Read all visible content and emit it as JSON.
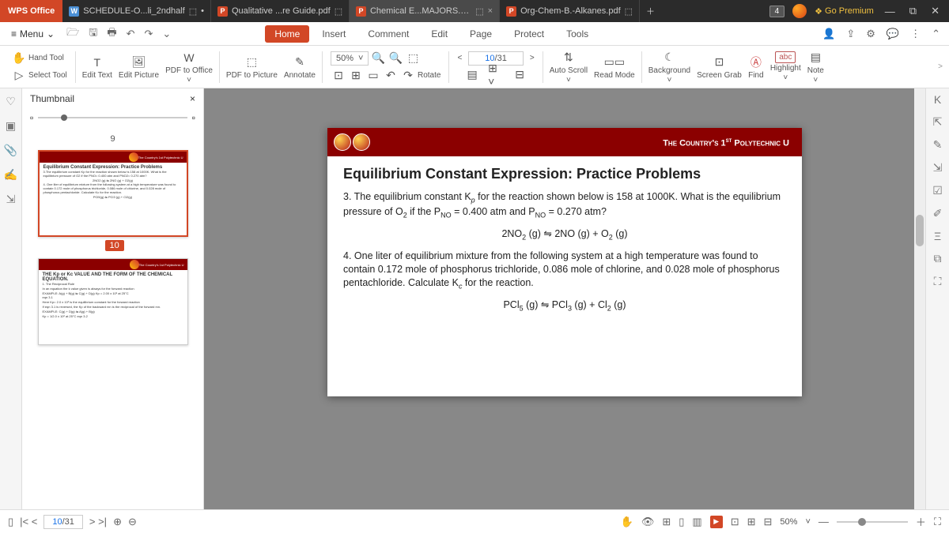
{
  "titlebar": {
    "logo": "WPS Office",
    "tabs": [
      {
        "icon": "w",
        "label": "SCHEDULE-O...li_2ndhalf"
      },
      {
        "icon": "p",
        "label": "Qualitative ...re Guide.pdf"
      },
      {
        "icon": "p",
        "label": "Chemical E...MAJORS.pdf",
        "active": true
      },
      {
        "icon": "p",
        "label": "Org-Chem-B.-Alkanes.pdf"
      }
    ],
    "badge": "4",
    "premium": "Go Premium"
  },
  "menubar": {
    "menu": "Menu",
    "tabs": [
      "Home",
      "Insert",
      "Comment",
      "Edit",
      "Page",
      "Protect",
      "Tools"
    ]
  },
  "toolbar": {
    "hand": "Hand Tool",
    "select": "Select Tool",
    "edittext": "Edit Text",
    "editpic": "Edit Picture",
    "pdf2office": "PDF to Office",
    "pdf2pic": "PDF to Picture",
    "annotate": "Annotate",
    "zoom": "50%",
    "rotate": "Rotate",
    "page_cur": "10",
    "page_total": "/31",
    "autoscroll": "Auto Scroll",
    "readmode": "Read Mode",
    "background": "Background",
    "screengrab": "Screen Grab",
    "find": "Find",
    "highlight": "Highlight",
    "note": "Note",
    "abc": "abc"
  },
  "thumbpanel": {
    "title": "Thumbnail",
    "nums": [
      "9",
      "10"
    ]
  },
  "doc": {
    "banner": "The Country's 1",
    "banner_st": "st",
    "banner2": " Polytechnic U",
    "title": "Equilibrium Constant Expression: Practice Problems",
    "q3": "3. The equilibrium constant K",
    "q3_sub": "p",
    "q3b": " for the reaction shown below is 158 at 1000K.  What is the equilibrium pressure of O",
    "q3_sub2": "2",
    "q3c": " if the P",
    "q3_sub3": "NO",
    "q3d": " = 0.400 atm and P",
    "q3_sub4": "NO",
    "q3e": " = 0.270 atm?",
    "eq1a": "2NO",
    "eq1b": " (g)   ⇋  2NO (g) + O",
    "eq1c": " (g)",
    "q4": "4. One liter of equilibrium mixture from the following system at a high temperature was found to contain 0.172 mole of phosphorus trichloride, 0.086 mole of chlorine, and 0.028 mole of phosphorus pentachloride.  Calculate K",
    "q4_sub": "c",
    "q4b": " for the reaction.",
    "eq2a": "PCl",
    "eq2b": " (g) ⇋ PCl",
    "eq2c": " (g)  + Cl",
    "eq2d": " (g)"
  },
  "thumbmini": {
    "banner": "The Country's 1st Polytechnic U",
    "t1": "Equilibrium Constant Expression: Practice Problems",
    "t1p1": "3.The equilibrium constant Kp for the reaction shown below is 158 at 1000K. What is the equilibrium pressure of O2 if the PNO= 0.400 atm and PNO2= 0.270 atm?",
    "t1eq1": "2NO2 (g) ⇋ 2NO (g) + O2(g)",
    "t1p2": "4. One liter of equilibrium mixture from the following system at a high temperature was found to contain 0.172 mole of phosphorus trichloride, 0.086 mole of chlorine, and 0.028 mole of phosphorus pentachloride. Calculate Kc for the reaction.",
    "t1eq2": "PCl5(g) ⇋ PCl3 (g) + Cl2(g)",
    "t2": "THE Kp or Kc VALUE AND THE FORM OF THE CHEMICAL EQUATION.",
    "t2p1": "1. The Reciprocal Rule",
    "t2p2": "In an equation the k value given is always for the forward reaction",
    "t2p3": "EXAMPLE: A(g) + B(g) ⇋ C(g) + D(g)   Kp = 2.00 x 10² at 25°C",
    "t2p4": "eqn 3.1",
    "t2p5": "Here Kp= 2.0 x 10² is the equilibrium constant for the forward reaction",
    "t2p6": "If eqn 3.1 is reversed, the Kp of the backward rxn is the reciprocal of the forward rxn.",
    "t2p7": "EXAMPLE: C(g) + D(g) ⇋ A(g) + B(g)",
    "t2p8": "Kp = 1/2.0 x 10² at 25°C   eqn 3.2"
  },
  "status": {
    "page_cur": "10",
    "page_total": "/31",
    "zoom": "50%"
  }
}
